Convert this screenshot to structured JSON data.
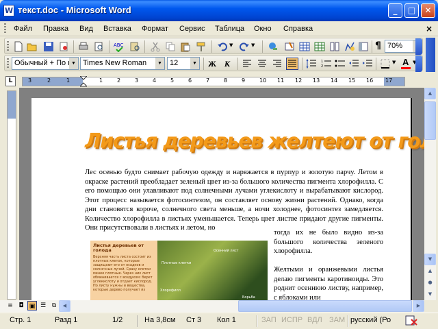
{
  "window": {
    "title": "текст.doc - Microsoft Word",
    "app_icon": "word-doc-icon",
    "controls": [
      "minimize-icon",
      "maximize-icon",
      "close-icon"
    ]
  },
  "menu": {
    "items": [
      "Файл",
      "Правка",
      "Вид",
      "Вставка",
      "Формат",
      "Сервис",
      "Таблица",
      "Окно",
      "Справка"
    ],
    "close_glyph": "×"
  },
  "standard_toolbar": {
    "icons": [
      "new-document-icon",
      "open-icon",
      "save-icon",
      "permission-icon",
      "print-icon",
      "print-preview-icon",
      "spelling-icon",
      "research-icon",
      "cut-icon",
      "copy-icon",
      "paste-icon",
      "format-painter-icon",
      "undo-icon",
      "redo-icon",
      "hyperlink-icon",
      "tables-borders-icon",
      "insert-table-icon",
      "insert-excel-icon",
      "columns-icon",
      "drawing-icon",
      "document-map-icon",
      "show-formatting-icon"
    ],
    "zoom": "70%"
  },
  "formatting_toolbar": {
    "style": "Обычный + По ц",
    "font": "Times New Roman",
    "size": "12",
    "bold": "Ж",
    "italic": "К",
    "alignment_icons": [
      "align-left-icon",
      "align-center-icon",
      "align-right-icon",
      "justify-icon"
    ],
    "list_icons": [
      "line-spacing-icon",
      "numbering-icon",
      "bullets-icon",
      "decrease-indent-icon",
      "increase-indent-icon"
    ],
    "border_icon": "borders-icon",
    "font_color_icon": "font-color-icon",
    "font_color": "#ff0000",
    "highlight_color": "#f3c06b"
  },
  "ruler": {
    "tab_glyph": "L",
    "numbers": [
      "3",
      "2",
      "1",
      "1",
      "2",
      "3",
      "4",
      "5",
      "6",
      "7",
      "8",
      "9",
      "10",
      "11",
      "12",
      "13",
      "14",
      "15",
      "16",
      "17"
    ]
  },
  "document": {
    "heading": "Листья деревьев желтеют от голода",
    "heading_color": "#f39a1a",
    "paragraph1": "Лес осенью будто снимает рабочую одежду и наряжается в пурпур и золотую парчу. Летом в окраске растений преобладает зеленый цвет из-за большого количества пигмента хлорофилла. С его помощью они улавливают под солнечными лучами углекислоту и вырабатывают кислород. Этот процесс называется фотосинтезом, он составляет основу жизни растений. Однако, когда дни становятся короче, солнечного света меньше, а ночи холоднее, фотосинтез замедляется. Количество хлорофилла в листьях уменьшается. Теперь цвет листве придают другие пигменты. Они присутствовали в листьях и летом, но",
    "paragraph1_cont": "тогда их не было видно из-за большого количества зеленого хлорофилла.",
    "paragraph2": "Желтыми и оранжевыми листья делаю пигменты каротиноиды. Это роднит осеннюю листву, например, с яблоками или",
    "figure": {
      "title": "Листья деревьев от голода",
      "caption": "Верхняя часть листа состоит из плотных клеток, которые защищают его от осадков и солнечных лучей. Сразу клетки менее плотные. Через них лист обменивается с воздухом: берет углекислоту и отдает кислород. По листу нужны и вещества, которые дерево получает из",
      "labels": [
        "Осенний лист",
        "Плотные клетки",
        "Хлорофилл",
        "Борьба"
      ]
    }
  },
  "scrollbar": {
    "up": "▲",
    "down": "▼",
    "prev_page": "▲",
    "select_object": "●",
    "next_page": "▼"
  },
  "view_buttons": [
    "normal-view-icon",
    "web-view-icon",
    "print-layout-icon",
    "outline-icon",
    "reading-view-icon"
  ],
  "status": {
    "page": "Стр. 1",
    "section": "Разд 1",
    "pages": "1/2",
    "at": "На 3,8см",
    "line": "Ст 3",
    "col": "Кол 1",
    "rec": "ЗАП",
    "trk": "ИСПР",
    "ext": "ВДЛ",
    "ovr": "ЗАМ",
    "language": "русский (Ро",
    "spelling_icon": "spelling-status-icon"
  }
}
